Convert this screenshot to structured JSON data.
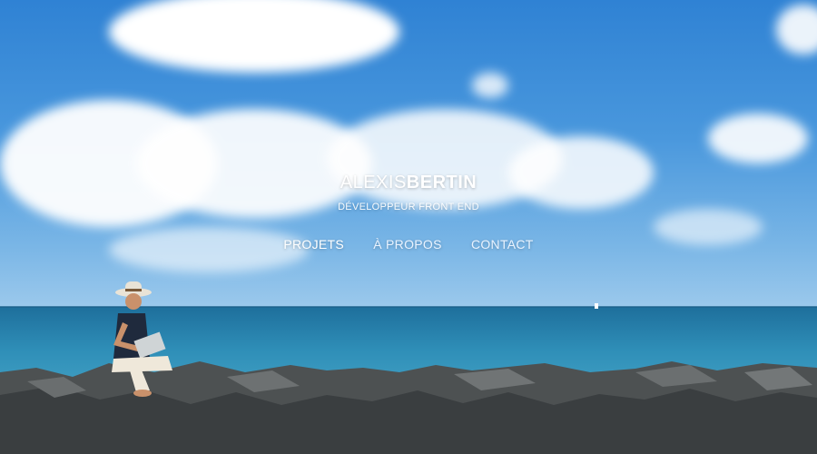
{
  "brand": {
    "first": "ALEXIS",
    "last": "BERTIN"
  },
  "subtitle": "DÉVELOPPEUR FRONT END",
  "nav": {
    "items": [
      {
        "label": "PROJETS",
        "active": true
      },
      {
        "label": "À PROPOS",
        "active": false
      },
      {
        "label": "CONTACT",
        "active": false
      }
    ]
  },
  "colors": {
    "sky": "#3b8fd9",
    "sea": "#2f8fb8",
    "text": "#ffffff"
  }
}
